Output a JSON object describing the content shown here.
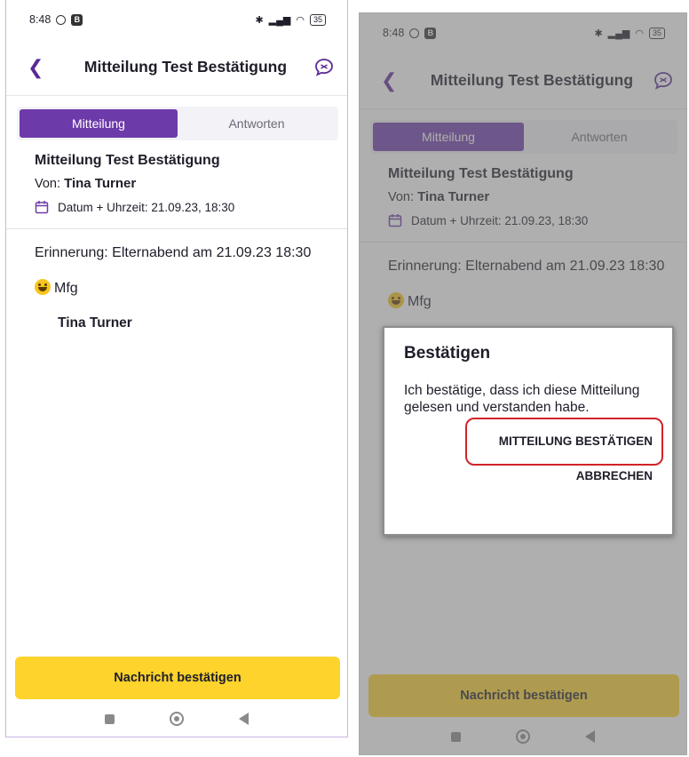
{
  "status": {
    "time": "8:48",
    "battery": "35"
  },
  "header": {
    "title": "Mitteilung Test Bestätigung"
  },
  "tabs": [
    {
      "label": "Mitteilung",
      "active": true
    },
    {
      "label": "Antworten",
      "active": false
    }
  ],
  "message": {
    "title": "Mitteilung Test Bestätigung",
    "from_label": "Von:",
    "from_name": "Tina Turner",
    "date_text": "Datum + Uhrzeit: 21.09.23, 18:30",
    "body_line": "Erinnerung: Elternabend am 21.09.23 18:30",
    "greeting": "Mfg",
    "signature": "Tina Turner"
  },
  "action": {
    "confirm_label": "Nachricht bestätigen"
  },
  "dialog": {
    "title": "Bestätigen",
    "text": "Ich bestätige, dass ich diese Mitteilung gelesen und verstanden habe.",
    "confirm_label": "MITTEILUNG BESTÄTIGEN",
    "cancel_label": "ABBRECHEN"
  },
  "colors": {
    "accent": "#6d3aaa",
    "button": "#fed32c",
    "highlight": "#d2232a"
  },
  "icons": [
    "back-icon",
    "chat-icon",
    "calendar-icon",
    "nav-recents-icon",
    "nav-home-icon",
    "nav-back-icon"
  ]
}
